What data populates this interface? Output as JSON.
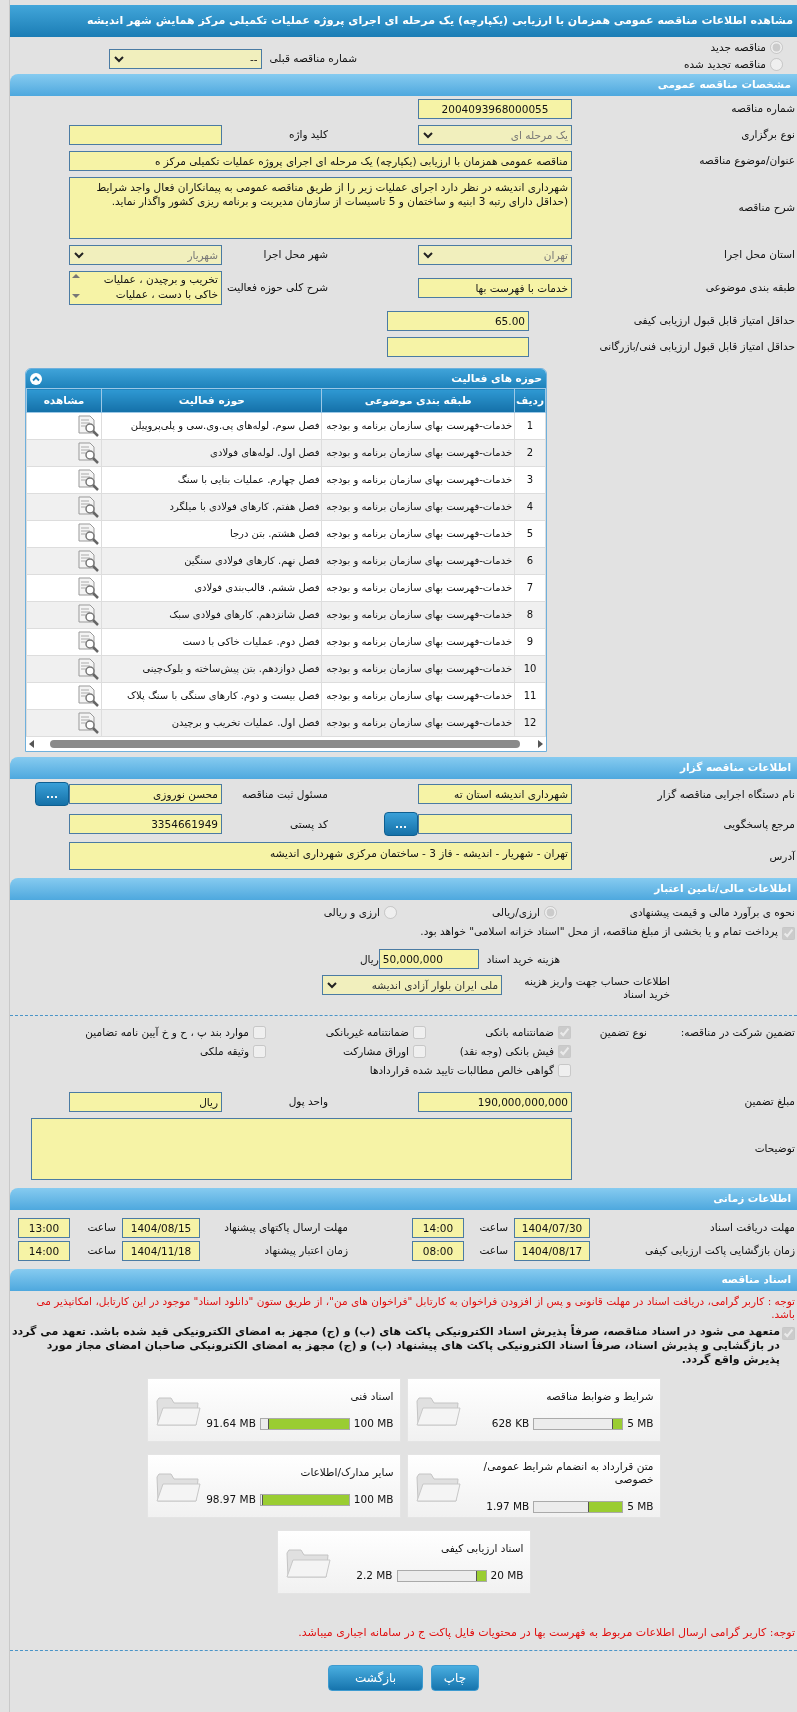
{
  "title": "مشاهده اطلاعات مناقصه عمومی همزمان با ارزیابی (یکپارچه) یک مرحله ای اجرای پروژه عملیات تکمیلی مرکز همایش شهر اندیشه",
  "tender_kind": [
    {
      "label": "مناقصه جدید",
      "selected": true
    },
    {
      "label": "مناقصه تجدید شده",
      "selected": false
    }
  ],
  "previous_tender": {
    "label": "شماره مناقصه قبلی",
    "value": "--"
  },
  "general": {
    "header": "مشخصات مناقصه عمومی",
    "rows": [
      {
        "kind": "single",
        "fields": [
          {
            "label": "شماره مناقصه",
            "value": "2004093968000055",
            "kind": "number"
          }
        ]
      },
      {
        "kind": "pair",
        "fields": [
          {
            "label": "نوع برگزاری",
            "value": "یک مرحله ای",
            "kind": "select"
          },
          {
            "label": "کلید واژه",
            "kind": "input"
          }
        ]
      },
      {
        "kind": "wide",
        "fields": [
          {
            "label": "عنوان/موضوع مناقصه",
            "value": "مناقصه عمومی همزمان با ارزیابی (یکپارچه) یک مرحله ای اجرای پروژه عملیات تکمیلی مرکز ه",
            "kind": "input"
          }
        ]
      },
      {
        "kind": "wide",
        "fields": [
          {
            "label": "شرح مناقصه",
            "value": "شهرداری اندیشه در نظر دارد اجرای عملیات زیر را  از طریق مناقصه عمومی به پیمانکاران فعال واجد شرایط (حداقل دارای رتبه 3 ابنیه و ساختمان و 5 تاسیسات از سازمان مدیریت و برنامه ریزی کشور واگذار نماید.",
            "kind": "textarea"
          }
        ]
      },
      {
        "kind": "pair",
        "fields": [
          {
            "label": "استان محل اجرا",
            "value": "تهران",
            "kind": "select"
          },
          {
            "label": "شهر محل اجرا",
            "value": "شهریار",
            "kind": "select"
          }
        ]
      },
      {
        "kind": "pair",
        "fields": [
          {
            "label": "طبقه بندی موضوعی",
            "value": "خدمات با فهرست بها",
            "kind": "input"
          },
          {
            "label": "شرح کلی حوزه فعالیت",
            "value": "تخریب و برچیدن ، عملیات خاکی با دست ، عملیات",
            "kind": "listbox"
          }
        ]
      },
      {
        "kind": "score",
        "fields": [
          {
            "label": "حداقل امتیاز قابل قبول ارزیابی کیفی",
            "value": "65.00",
            "kind": "input"
          }
        ]
      },
      {
        "kind": "score",
        "fields": [
          {
            "label": "حداقل امتیاز قابل قبول ارزیابی فنی/بازرگانی",
            "kind": "input"
          }
        ]
      }
    ]
  },
  "activities": {
    "title": "حوزه های فعالیت",
    "columns": [
      "ردیف",
      "طبقه بندی موضوعی",
      "حوزه فعالیت",
      "مشاهده"
    ],
    "rows": [
      {
        "index": "1",
        "category": "خدمات-فهرست بهای سازمان برنامه و بودجه",
        "activity": "فصل سوم. لوله‌های پی.وی.سی و پلی‌پروپیلن"
      },
      {
        "index": "2",
        "category": "خدمات-فهرست بهای سازمان برنامه و بودجه",
        "activity": "فصل اول. لوله‌های فولادی"
      },
      {
        "index": "3",
        "category": "خدمات-فهرست بهای سازمان برنامه و بودجه",
        "activity": "فصل چهارم. عملیات بنایی با سنگ"
      },
      {
        "index": "4",
        "category": "خدمات-فهرست بهای سازمان برنامه و بودجه",
        "activity": "فصل هفتم. کارهای فولادی با میلگرد"
      },
      {
        "index": "5",
        "category": "خدمات-فهرست بهای سازمان برنامه و بودجه",
        "activity": "فصل هشتم. بتن درجا"
      },
      {
        "index": "6",
        "category": "خدمات-فهرست بهای سازمان برنامه و بودجه",
        "activity": "فصل نهم. کارهای فولادی سنگین"
      },
      {
        "index": "7",
        "category": "خدمات-فهرست بهای سازمان برنامه و بودجه",
        "activity": "فصل ششم. قالب‌بندی فولادی"
      },
      {
        "index": "8",
        "category": "خدمات-فهرست بهای سازمان برنامه و بودجه",
        "activity": "فصل شانزدهم. کارهای فولادی سبک"
      },
      {
        "index": "9",
        "category": "خدمات-فهرست بهای سازمان برنامه و بودجه",
        "activity": "فصل دوم. عملیات خاکی با دست"
      },
      {
        "index": "10",
        "category": "خدمات-فهرست بهای سازمان برنامه و بودجه",
        "activity": "فصل دوازدهم. بتن پیش‌ساخته و بلوک‌چینی"
      },
      {
        "index": "11",
        "category": "خدمات-فهرست بهای سازمان برنامه و بودجه",
        "activity": "فصل بیست و دوم. کارهای سنگی با سنگ پلاک"
      },
      {
        "index": "12",
        "category": "خدمات-فهرست بهای سازمان برنامه و بودجه",
        "activity": "فصل اول. عملیات تخریب و برچیدن"
      }
    ]
  },
  "organizer": {
    "header": "اطلاعات مناقصه گزار",
    "rows": [
      {
        "kind": "pair",
        "fields": [
          {
            "label": "نام دستگاه اجرایی مناقصه گزار",
            "value": "شهرداری اندیشه استان ته",
            "kind": "input"
          },
          {
            "label": "مسئول ثبت مناقصه",
            "value": "محسن نوروزی",
            "kind": "input",
            "button": "..."
          }
        ]
      },
      {
        "kind": "pair",
        "fields": [
          {
            "label": "مرجع پاسخگویی",
            "kind": "input",
            "button": "..."
          },
          {
            "label": "کد پستی",
            "value": "3354661949",
            "kind": "input"
          }
        ]
      },
      {
        "kind": "address",
        "fields": [
          {
            "label": "آدرس",
            "value": "تهران - شهریار - اندیشه - فاز 3 - ساختمان مرکزی شهرداری اندیشه",
            "kind": "textarea"
          }
        ]
      }
    ]
  },
  "finance": {
    "header": "اطلاعات مالی/تامین اعتبار",
    "estimate": {
      "label": "نحوه ی برآورد مالی و قیمت پیشنهادی",
      "options": [
        {
          "label": "ارزی/ریالی",
          "selected": true
        },
        {
          "label": "ارزی و ریالی",
          "selected": false
        }
      ]
    },
    "treasury": {
      "label": "پرداخت تمام و یا بخشی از مبلغ مناقصه، از محل \"اسناد خزانه اسلامی\" خواهد بود.",
      "checked": true
    },
    "doc_fee": {
      "label": "هزینه خرید اسناد",
      "value": "50,000,000",
      "unit": "ریال"
    },
    "account": {
      "label": "اطلاعات حساب جهت واریز هزینه خرید اسناد",
      "value": "ملی ایران بلوار آزادی اندیشه"
    }
  },
  "guarantee": {
    "label": "تضمین شرکت در مناقصه:",
    "type_label": "نوع تضمین",
    "options": [
      {
        "label": "ضمانتنامه بانکی",
        "checked": true
      },
      {
        "label": "ضمانتنامه غیربانکی",
        "checked": false
      },
      {
        "label": "موارد بند پ ، ح و خ آیین نامه تضامین",
        "checked": false
      },
      {
        "label": "فیش بانکی (وجه نقد)",
        "checked": true
      },
      {
        "label": "اوراق مشارکت",
        "checked": false
      },
      {
        "label": "وثیقه ملکی",
        "checked": false
      },
      {
        "label": "گواهی خالص مطالبات تایید شده قراردادها",
        "checked": false
      }
    ],
    "rows": [
      {
        "kind": "pair",
        "fields": [
          {
            "label": "مبلغ تضمین",
            "value": "190,000,000,000",
            "kind": "input"
          },
          {
            "label": "واحد پول",
            "value": "ریال",
            "kind": "input"
          }
        ]
      },
      {
        "kind": "notes",
        "fields": [
          {
            "label": "توضیحات",
            "kind": "textarea"
          }
        ]
      }
    ]
  },
  "schedule": {
    "header": "اطلاعات زمانی",
    "items": [
      {
        "label": "مهلت دریافت اسناد",
        "date": "1404/07/30",
        "hour_label": "ساعت",
        "time": "14:00"
      },
      {
        "label": "مهلت ارسال پاکتهای پیشنهاد",
        "date": "1404/08/15",
        "hour_label": "ساعت",
        "time": "13:00"
      },
      {
        "label": "زمان بازگشایی پاکت ارزیابی کیفی",
        "date": "1404/08/17",
        "hour_label": "ساعت",
        "time": "08:00"
      },
      {
        "label": "زمان اعتبار پیشنهاد",
        "date": "1404/11/18",
        "hour_label": "ساعت",
        "time": "14:00"
      }
    ]
  },
  "documents": {
    "header": "اسناد مناقصه",
    "notice": "توجه : کاربر گرامی، دریافت اسناد در مهلت قانونی و پس از افزودن فراخوان به کارتابل \"فراخوان های من\"، از طریق ستون \"دانلود اسناد\" موجود در این کارتابل، امکانپذیر می باشد.",
    "commitment": {
      "label": "متعهد می شود در اسناد مناقصه، صرفاً پذیرش اسناد الکترونیکی پاکت های (ب) و (ج) مجهز به امضای الکترونیکی قید شده باشد. تعهد می گردد در بازگشایی و پذیرش اسناد، صرفاً اسناد الکترونیکی پاکت های پیشنهاد (ب) و (ج) مجهز به امضای الکترونیکی صاحبان امضای مجاز مورد پذیرش واقع گردد.",
      "checked": true
    },
    "files": [
      {
        "name": "شرایط و ضوابط مناقصه",
        "size": "628 KB",
        "max": "5 MB",
        "level": 0.12
      },
      {
        "name": "اسناد فنی",
        "size": "91.64 MB",
        "max": "100 MB",
        "level": 0.92
      },
      {
        "name": "متن قرارداد به انضمام شرایط عمومی/خصوصی",
        "size": "1.97 MB",
        "max": "5 MB",
        "level": 0.39
      },
      {
        "name": "سایر مدارک/اطلاعات",
        "size": "98.97 MB",
        "max": "100 MB",
        "level": 0.99
      },
      {
        "name": "اسناد ارزیابی کیفی",
        "size": "2.2 MB",
        "max": "20 MB",
        "level": 0.11
      }
    ],
    "note": "توجه: کاربر گرامی ارسال اطلاعات مربوط به فهرست بها در محتویات فایل پاکت ج در سامانه اجباری میباشد."
  },
  "buttons": [
    "چاپ",
    "بازگشت"
  ]
}
